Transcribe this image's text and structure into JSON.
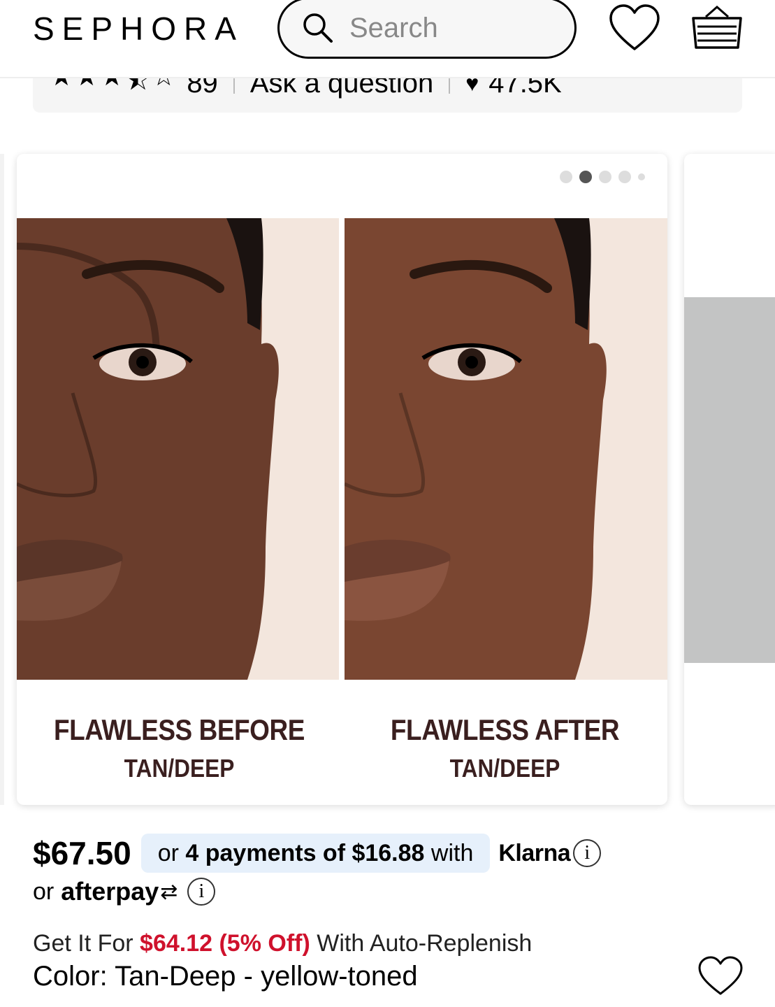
{
  "header": {
    "logo": "SEPHORA",
    "search_placeholder": "Search"
  },
  "rating": {
    "stars": 3.5,
    "review_count": "89",
    "ask_label": "Ask a question",
    "loves_count": "47.5K"
  },
  "carousel": {
    "dot_count": 5,
    "active_dot": 1,
    "before": {
      "title": "FLAWLESS BEFORE",
      "subtitle": "TAN/DEEP"
    },
    "after": {
      "title": "FLAWLESS AFTER",
      "subtitle": "TAN/DEEP"
    }
  },
  "pricing": {
    "price": "$67.50",
    "klarna_prefix": "or ",
    "klarna_bold": "4 payments of $16.88",
    "klarna_suffix": " with",
    "klarna_brand": "Klarna",
    "afterpay_prefix": "or",
    "afterpay_brand": "afterpay",
    "auto_prefix": "Get It For ",
    "auto_highlight": "$64.12 (5% Off)",
    "auto_suffix": " With Auto-Replenish"
  },
  "color_line": "Color: Tan-Deep - yellow-toned",
  "colors": {
    "accent_red": "#cf112c",
    "klarna_pill": "#e6f0fb",
    "caption": "#3a1f1f"
  }
}
